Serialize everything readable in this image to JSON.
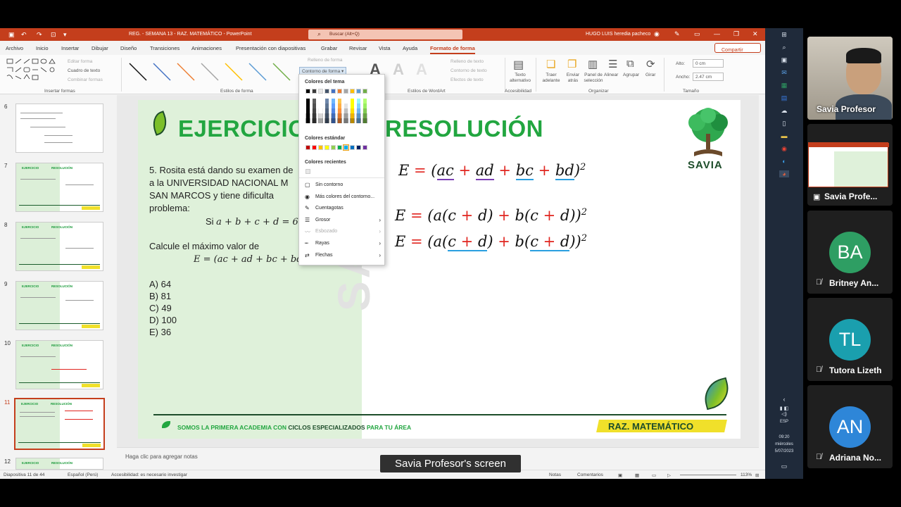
{
  "window": {
    "title": "REG. - SEMANA 13 - RAZ. MATEMÁTICO  -  PowerPoint",
    "search_placeholder": "Buscar (Alt+Q)",
    "user": "HUGO LUIS heredia pacheco"
  },
  "tabs": [
    "Archivo",
    "Inicio",
    "Insertar",
    "Dibujar",
    "Diseño",
    "Transiciones",
    "Animaciones",
    "Presentación con diapositivas",
    "Grabar",
    "Revisar",
    "Vista",
    "Ayuda",
    "Formato de forma"
  ],
  "active_tab": "Formato de forma",
  "share_label": "Compartir",
  "ribbon": {
    "groups": [
      "Insertar formas",
      "Estilos de forma",
      "Estilos de WordArt",
      "Accesibilidad",
      "Organizar",
      "Tamaño"
    ],
    "editar_forma": "Editar forma",
    "cuadro_texto": "Cuadro de texto",
    "combinar_formas": "Combinar formas",
    "relleno_forma": "Relleno de forma",
    "contorno_forma": "Contorno de forma",
    "relleno_texto": "Relleno de texto",
    "contorno_texto": "Contorno de texto",
    "efectos_texto": "Efectos de texto",
    "texto_alt": "Texto alternativo",
    "traer": "Traer adelante",
    "enviar": "Enviar atrás",
    "panel": "Panel de selección",
    "alinear": "Alinear",
    "agrupar": "Agrupar",
    "girar": "Girar",
    "alto_label": "Alto:",
    "alto_value": "0 cm",
    "ancho_label": "Ancho:",
    "ancho_value": "2.47 cm"
  },
  "slide_numbers": [
    "6",
    "7",
    "8",
    "9",
    "10",
    "11",
    "12"
  ],
  "thumb_titles": {
    "ejercicio": "EJERCICIO",
    "resolucion": "RESOLUCIÓN"
  },
  "slide": {
    "title_left": "EJERCICIO",
    "title_right": "RESOLUCIÓN",
    "logo": "SAVIA",
    "problem_lines": [
      "5. Rosita está dando su examen de",
      "a la UNIVERSIDAD NACIONAL M",
      "SAN MARCOS y tiene dificulta",
      "problema:"
    ],
    "condition_prefix": "Si ",
    "condition": "a + b + c + d = 6",
    "question": "Calcule el máximo valor de",
    "expression": "E = (ac + ad + bc + bd",
    "options": [
      "A) 64",
      "B) 81",
      "C) 49",
      "D) 100",
      "E) 36"
    ],
    "footer_a": "SOMOS LA PRIMERA ACADEMIA CON ",
    "footer_b": "CICLOS ESPECIALIZADOS",
    "footer_c": " PARA TU ÁREA",
    "subject": "RAZ. MATEMÁTICO",
    "watermark": "SAVIA"
  },
  "menu": {
    "theme_colors_label": "Colores del tema",
    "standard_colors_label": "Colores estándar",
    "recent_colors_label": "Colores recientes",
    "items": [
      {
        "label": "Sin contorno",
        "icon": "none-icon",
        "arrow": false,
        "disabled": false
      },
      {
        "label": "Más colores del contorno...",
        "icon": "palette-icon",
        "arrow": false,
        "disabled": false
      },
      {
        "label": "Cuentagotas",
        "icon": "eyedropper-icon",
        "arrow": false,
        "disabled": false
      },
      {
        "label": "Grosor",
        "icon": "weight-icon",
        "arrow": true,
        "disabled": false
      },
      {
        "label": "Esbozado",
        "icon": "sketch-icon",
        "arrow": true,
        "disabled": true
      },
      {
        "label": "Rayas",
        "icon": "dashes-icon",
        "arrow": true,
        "disabled": false
      },
      {
        "label": "Flechas",
        "icon": "arrows-icon",
        "arrow": true,
        "disabled": false
      }
    ],
    "theme_top": [
      "#000000",
      "#3a3a3a",
      "#e7e6e6",
      "#44546a",
      "#4472c4",
      "#ed7d31",
      "#a5a5a5",
      "#ffc000",
      "#5b9bd5",
      "#70ad47"
    ],
    "standard": [
      "#c00000",
      "#ff0000",
      "#ffc000",
      "#ffff00",
      "#92d050",
      "#00b050",
      "#00b0f0",
      "#0070c0",
      "#002060",
      "#7030a0"
    ]
  },
  "notes_placeholder": "Haga clic para agregar notas",
  "status": {
    "slide_info": "Diapositiva 11 de 44",
    "language": "Español (Perú)",
    "accessibility": "Accesibilidad: es necesario investigar",
    "notes": "Notas",
    "comments": "Comentarios",
    "zoom": "113%"
  },
  "taskbar": {
    "lang": "ESP",
    "time": "09:20",
    "day": "miércoles",
    "date": "5/07/2023"
  },
  "participants": [
    {
      "name": "Savia Profesor",
      "initials": "",
      "color": "#3a3a3a",
      "muted": false
    },
    {
      "name": "Savia Profe...",
      "initials": "",
      "color": "#ffffff",
      "muted": false
    },
    {
      "name": "Britney An...",
      "initials": "BA",
      "color": "#2e9e63",
      "muted": true
    },
    {
      "name": "Tutora Lizeth",
      "initials": "TL",
      "color": "#1a9fae",
      "muted": true
    },
    {
      "name": "Adriana No...",
      "initials": "AN",
      "color": "#2e86d8",
      "muted": true
    }
  ],
  "screen_caption": "Savia Profesor's screen"
}
